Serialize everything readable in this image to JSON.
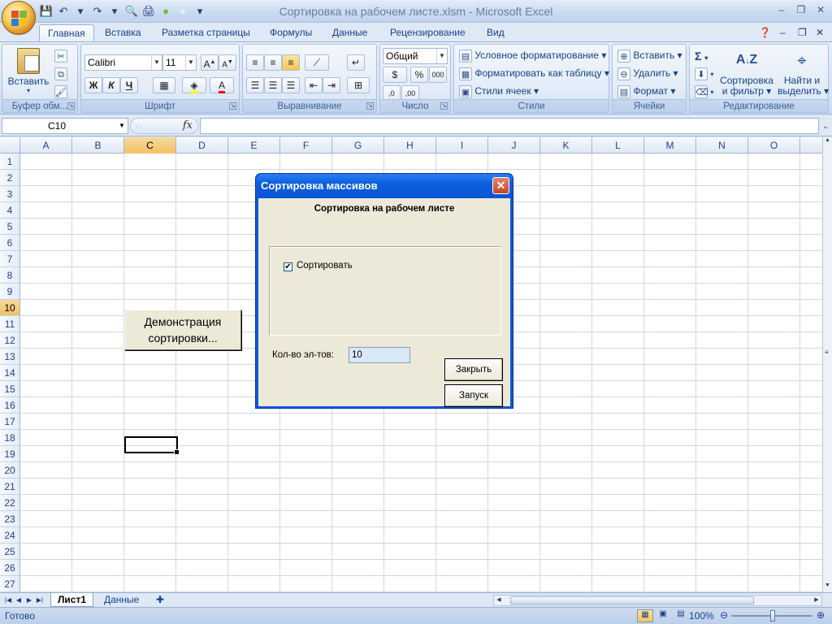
{
  "window": {
    "title": "Сортировка на рабочем листе.xlsm - Microsoft Excel",
    "minimize": "–",
    "restore": "❐",
    "close": "✕"
  },
  "qat": {
    "save": "💾",
    "undo": "↶",
    "redo": "↷",
    "print_preview": "🔍",
    "print": "🖨",
    "circle": "●",
    "more": "▾"
  },
  "tabs": [
    {
      "label": "Главная"
    },
    {
      "label": "Вставка"
    },
    {
      "label": "Разметка страницы"
    },
    {
      "label": "Формулы"
    },
    {
      "label": "Данные"
    },
    {
      "label": "Рецензирование"
    },
    {
      "label": "Вид"
    }
  ],
  "ribbon": {
    "clipboard": {
      "label": "Буфер обм...",
      "paste": "Вставить"
    },
    "font": {
      "label": "Шрифт",
      "name": "Calibri",
      "size": "11",
      "bold": "Ж",
      "italic": "К",
      "underline": "Ч"
    },
    "alignment": {
      "label": "Выравнивание"
    },
    "number": {
      "label": "Число",
      "format": "Общий",
      "percent": "%",
      "thousands": "000"
    },
    "styles": {
      "label": "Стили",
      "conditional": "Условное форматирование",
      "as_table": "Форматировать как таблицу",
      "cell_styles": "Стили ячеек"
    },
    "cells": {
      "label": "Ячейки",
      "insert": "Вставить",
      "delete": "Удалить",
      "format": "Формат"
    },
    "editing": {
      "label": "Редактирование",
      "sort_line1": "Сортировка",
      "sort_line2": "и фильтр",
      "find_line1": "Найти и",
      "find_line2": "выделить",
      "sigma": "Σ"
    }
  },
  "formula_bar": {
    "name_box": "C10",
    "fx": "fx",
    "value": ""
  },
  "columns": [
    "A",
    "B",
    "C",
    "D",
    "E",
    "F",
    "G",
    "H",
    "I",
    "J",
    "K",
    "L",
    "M",
    "N",
    "O"
  ],
  "rows": [
    "1",
    "2",
    "3",
    "4",
    "5",
    "6",
    "7",
    "8",
    "9",
    "10",
    "11",
    "12",
    "13",
    "14",
    "15",
    "16",
    "17",
    "18",
    "19",
    "20",
    "21",
    "22",
    "23",
    "24",
    "25",
    "26",
    "27"
  ],
  "selected": {
    "column": "C",
    "row": "10"
  },
  "demo_button": {
    "line1": "Демонстрация",
    "line2": "сортировки..."
  },
  "dialog": {
    "title": "Сортировка массивов",
    "heading": "Сортировка на рабочем листе",
    "checkbox_label": "Сортировать",
    "checkbox_checked": true,
    "count_label": "Кол-во эл-тов:",
    "count_value": "10",
    "close_button": "Закрыть",
    "run_button": "Запуск"
  },
  "sheets": [
    {
      "label": "Лист1"
    },
    {
      "label": "Данные"
    }
  ],
  "status": {
    "text": "Готово",
    "zoom": "100%"
  }
}
